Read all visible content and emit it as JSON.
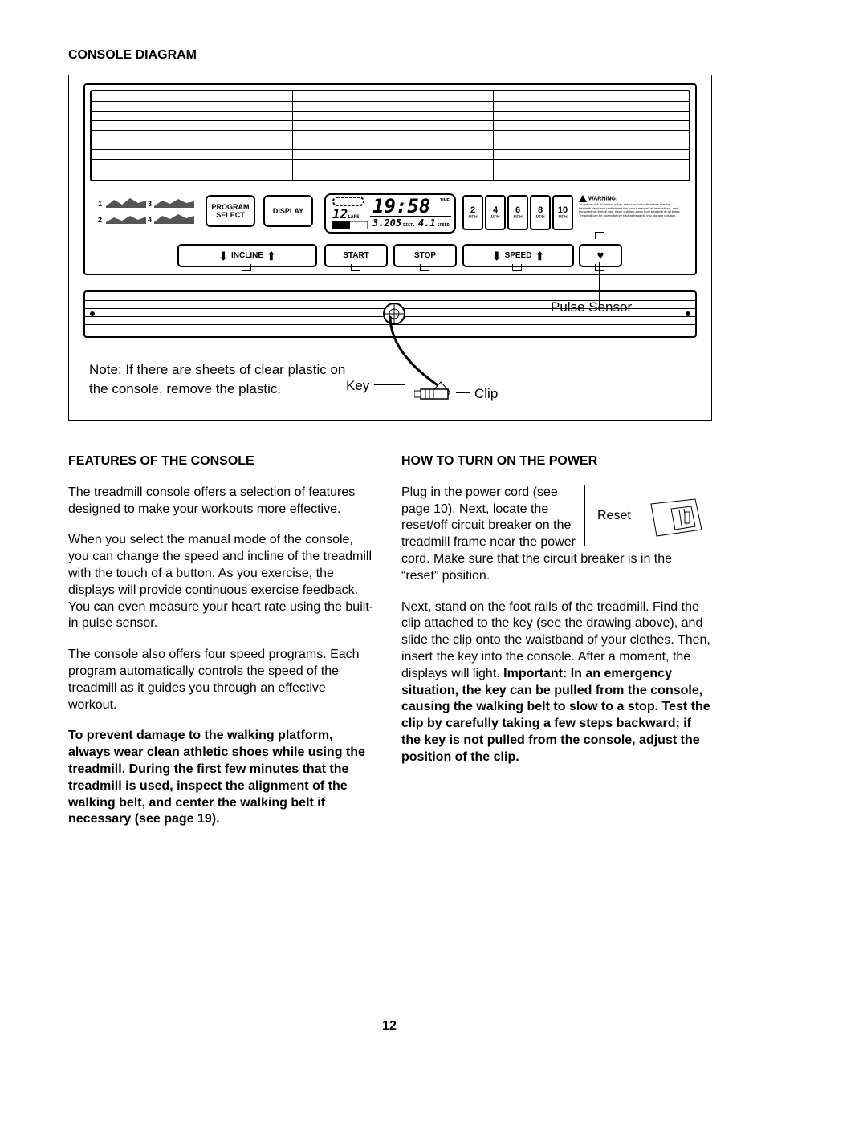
{
  "page_number": "12",
  "title_diagram": "CONSOLE DIAGRAM",
  "diagram": {
    "buttons": {
      "program_select_line1": "PROGRAM",
      "program_select_line2": "SELECT",
      "display": "DISPLAY",
      "incline": "INCLINE",
      "start": "START",
      "stop": "STOP",
      "speed": "SPEED"
    },
    "lcd": {
      "laps_val": "12",
      "laps_lbl": "LAPS",
      "time_val": "19:58",
      "time_lbl": "TIME",
      "dist_val": "3.205",
      "dist_lbl": "DIST.",
      "speed_val": "4.1",
      "speed_lbl": "SPEED"
    },
    "mph": [
      "2",
      "4",
      "6",
      "8",
      "10"
    ],
    "mph_sub": "MPH",
    "profile_nums": [
      "1",
      "2",
      "3",
      "4"
    ],
    "warning_head": "WARNING:",
    "warning_body": "To reduce risk of serious injury, stand on foot rails before starting treadmill, read and understand the user's manual, all instructions, and the warnings before use. Keep children away from treadmill at all times. Treadmill can be stored before folding treadmill into storage position.",
    "labels": {
      "pulse_sensor": "Pulse Sensor",
      "key": "Key",
      "clip": "Clip"
    },
    "note": "Note: If there are sheets of clear plastic on the console, remove the plastic."
  },
  "features": {
    "heading": "FEATURES OF THE CONSOLE",
    "p1": "The treadmill console offers a selection of features designed to make your workouts more effective.",
    "p2": "When you select the manual mode of the console, you can change the speed and incline of the treadmill with the touch of a button. As you exercise, the displays will provide continuous exercise feedback. You can even measure your heart rate using the built-in pulse sensor.",
    "p3": "The console also offers four speed programs. Each program automatically controls the speed of the treadmill as it guides you through an effective workout.",
    "p4": "To prevent damage to the walking platform, always wear clean athletic shoes while using the treadmill. During the first few minutes that the treadmill is used, inspect the alignment of the walking belt, and center the walking belt if necessary (see page 19)."
  },
  "power": {
    "heading": "HOW TO TURN ON THE POWER",
    "reset_label": "Reset",
    "p1": "Plug in the power cord (see page 10). Next, locate the reset/off circuit breaker on the treadmill frame near the power cord. Make sure that the circuit breaker is in the “reset” position.",
    "p2a": "Next, stand on the foot rails of the treadmill. Find the clip attached to the key (see the drawing above), and slide the clip onto the waistband of your clothes. Then, insert the key into the console. After a moment, the displays will light. ",
    "p2b": "Important: In an emergency situation, the key can be pulled from the console, causing the walking belt to slow to a stop. Test the clip by carefully taking a few steps backward; if the key is not pulled from the console, adjust the position of the clip."
  }
}
